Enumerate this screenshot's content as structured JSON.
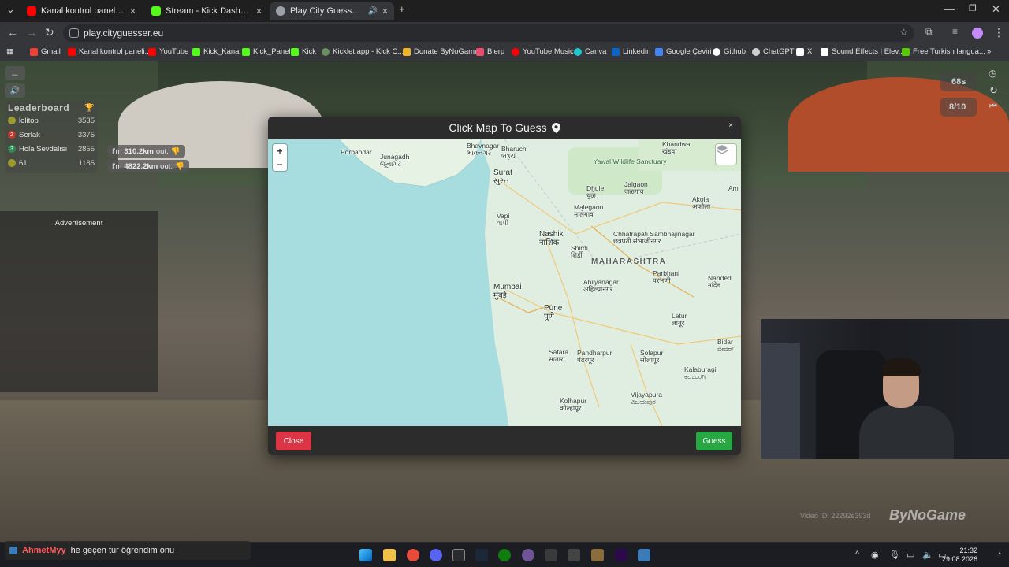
{
  "browser": {
    "tabs": [
      {
        "label": "Kanal kontrol paneli - YouTube",
        "favicon_color": "#ff0000",
        "active": false
      },
      {
        "label": "Stream - Kick Dashboard",
        "favicon_color": "#53fc18",
        "active": false
      },
      {
        "label": "Play City Guesser - Explore",
        "favicon_color": "#9aa0a6",
        "active": true
      }
    ],
    "new_tab": "+",
    "url": "play.cityguesser.eu",
    "bookmarks": [
      {
        "label": "Gmail",
        "color": "#ea4335"
      },
      {
        "label": "Kanal kontrol paneli...",
        "color": "#ff0000"
      },
      {
        "label": "YouTube",
        "color": "#ff0000"
      },
      {
        "label": "Kick_Kanal",
        "color": "#53fc18"
      },
      {
        "label": "Kick_Panel",
        "color": "#53fc18"
      },
      {
        "label": "Kick",
        "color": "#53fc18"
      },
      {
        "label": "Kicklet.app - Kick C...",
        "color": "#6b8f5e"
      },
      {
        "label": "Donate ByNoGame",
        "color": "#f0b429"
      },
      {
        "label": "Blerp",
        "color": "#e84c6e"
      },
      {
        "label": "YouTube Music",
        "color": "#ff0000"
      },
      {
        "label": "Canva",
        "color": "#20c4cb"
      },
      {
        "label": "Linkedin",
        "color": "#0a66c2"
      },
      {
        "label": "Google Çeviri",
        "color": "#4285f4"
      },
      {
        "label": "Github",
        "color": "#ffffff"
      },
      {
        "label": "ChatGPT",
        "color": "#cfcfcf"
      },
      {
        "label": "X",
        "color": "#ffffff"
      },
      {
        "label": "Sound Effects | Elev...",
        "color": "#ffffff"
      },
      {
        "label": "Free Turkish langua...",
        "color": "#58cc02"
      }
    ]
  },
  "game": {
    "leaderboard_title": "Leaderboard",
    "leaderboard": [
      {
        "rank": "",
        "name": "lolitop",
        "score": "3535",
        "color": "#9a9a2e"
      },
      {
        "rank": "2",
        "name": "Serlak",
        "score": "3375",
        "color": "#c0392b"
      },
      {
        "rank": "3",
        "name": "Hola Sevdalısı",
        "score": "2855",
        "color": "#2e8b57"
      },
      {
        "rank": "",
        "name": "61",
        "score": "1185",
        "color": "#9a9a2e"
      }
    ],
    "bubbles": [
      {
        "prefix": "I'm",
        "distance": "310.2km",
        "suffix": "out."
      },
      {
        "prefix": "I'm",
        "distance": "4822.2km",
        "suffix": "out."
      }
    ],
    "advertisement": "Advertisement",
    "timer": "68s",
    "round": "8/10"
  },
  "modal": {
    "title": "Click Map To Guess",
    "close_label": "Close",
    "guess_label": "Guess",
    "zoom_in": "+",
    "zoom_out": "−",
    "close_x": "×"
  },
  "map": {
    "labels": [
      {
        "name": "Bhavnagar",
        "sub": "ભાવનગર"
      },
      {
        "name": "Bharuch",
        "sub": "ભરૂચ"
      },
      {
        "name": "Porbandar",
        "sub": ""
      },
      {
        "name": "Junagadh",
        "sub": "જૂનાગઢ"
      },
      {
        "name": "Khandwa",
        "sub": "खंडवा"
      },
      {
        "name": "Surat",
        "sub": "સુરત"
      },
      {
        "name": "Yawal Wildlife Sanctuary",
        "sub": ""
      },
      {
        "name": "Dhule",
        "sub": "धुळे"
      },
      {
        "name": "Jalgaon",
        "sub": "जळगाव"
      },
      {
        "name": "Am",
        "sub": ""
      },
      {
        "name": "Vapi",
        "sub": "વાપી"
      },
      {
        "name": "Malegaon",
        "sub": "मालेगाव"
      },
      {
        "name": "Akola",
        "sub": "अकोला"
      },
      {
        "name": "Nashik",
        "sub": "नाशिक"
      },
      {
        "name": "Shirdi",
        "sub": "शिर्डी"
      },
      {
        "name": "Chhatrapati Sambhajinagar",
        "sub": "छत्रपती संभाजीनगर"
      },
      {
        "name": "MAHARASHTRA",
        "sub": ""
      },
      {
        "name": "Parbhani",
        "sub": "परभणी"
      },
      {
        "name": "Nanded",
        "sub": "नांदेड"
      },
      {
        "name": "Mumbai",
        "sub": "मुंबई"
      },
      {
        "name": "Ahilyanagar",
        "sub": "अहिल्यानगर"
      },
      {
        "name": "Pune",
        "sub": "पुणे"
      },
      {
        "name": "Latur",
        "sub": "लातूर"
      },
      {
        "name": "Bidar",
        "sub": "ಬೀದರ್"
      },
      {
        "name": "Satara",
        "sub": "सातारा"
      },
      {
        "name": "Pandharpur",
        "sub": "पंढरपूर"
      },
      {
        "name": "Solapur",
        "sub": "सोलापूर"
      },
      {
        "name": "Kalaburagi",
        "sub": "ಕಲಬುರಗಿ"
      },
      {
        "name": "Vijayapura",
        "sub": "ವಿಜಯಪುರ"
      },
      {
        "name": "Kolhapur",
        "sub": "कोल्हापूर"
      }
    ]
  },
  "stream": {
    "video_id_text": "Video ID: 22292e393d",
    "brand": "ByNoGame",
    "chat_user": "AhmetMyy",
    "chat_message": "he geçen tur öğrendim onu"
  },
  "taskbar": {
    "time": "21:32",
    "date": "29.08.2026"
  }
}
